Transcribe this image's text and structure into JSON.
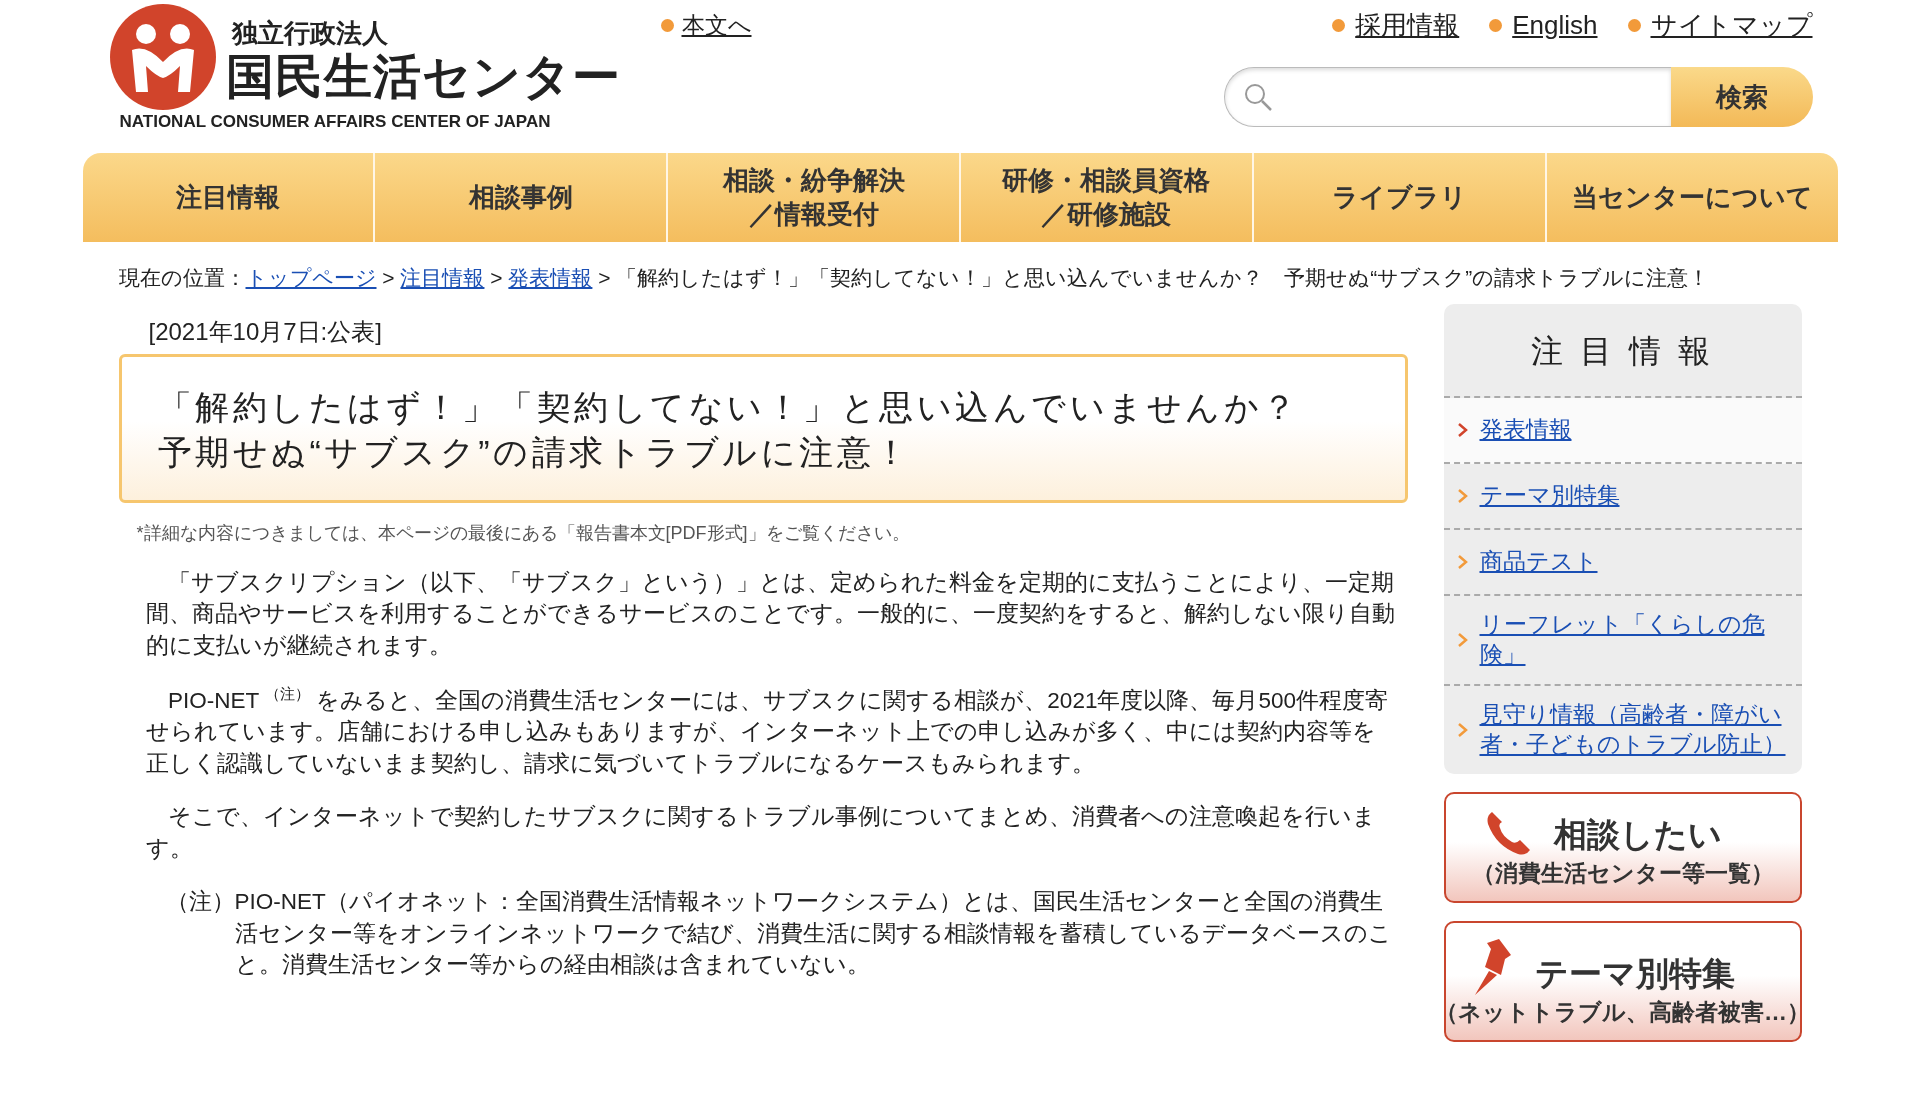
{
  "header": {
    "logo": {
      "org_type": "独立行政法人",
      "name": "国民生活センター",
      "english": "NATIONAL CONSUMER AFFAIRS CENTER OF JAPAN"
    },
    "skip_link": "本文へ",
    "top_links": [
      "採用情報",
      "English",
      "サイトマップ"
    ],
    "search": {
      "button": "検索"
    }
  },
  "nav": [
    {
      "lines": [
        "注目情報"
      ]
    },
    {
      "lines": [
        "相談事例"
      ]
    },
    {
      "lines": [
        "相談・紛争解決",
        "／情報受付"
      ]
    },
    {
      "lines": [
        "研修・相談員資格",
        "／研修施設"
      ]
    },
    {
      "lines": [
        "ライブラリ"
      ]
    },
    {
      "lines": [
        "当センターについて"
      ]
    }
  ],
  "breadcrumb": {
    "prefix": "現在の位置：",
    "links": [
      "トップページ",
      "注目情報",
      "発表情報"
    ],
    "separator": ">",
    "current": "「解約したはず！」「契約してない！」と思い込んでいませんか？　予期せぬ“サブスク”の請求トラブルに注意！"
  },
  "date": "[2021年10月7日:公表]",
  "title_lines": [
    "「解約したはず！」「契約してない！」と思い込んでいませんか？",
    "予期せぬ“サブスク”の請求トラブルに注意！"
  ],
  "note": "*詳細な内容につきましては、本ページの最後にある「報告書本文[PDF形式]」をご覧ください。",
  "paragraphs": [
    "「サブスクリプション（以下、「サブスク」という）」とは、定められた料金を定期的に支払うことにより、一定期間、商品やサービスを利用することができるサービスのことです。一般的に、一度契約をすると、解約しない限り自動的に支払いが継続されます。",
    "PIO-NET $^{（注）}$ をみると、全国の消費生活センターには、サブスクに関する相談が、2021年度以降、毎月500件程度寄せられています。店舗における申し込みもありますが、インターネット上での申し込みが多く、中には契約内容等を正しく認識していないまま契約し、請求に気づいてトラブルになるケースもみられます。",
    "そこで、インターネットで契約したサブスクに関するトラブル事例についてまとめ、消費者への注意喚起を行います。"
  ],
  "footnote": {
    "mark": "（注）",
    "text": "PIO-NET（パイオネット：全国消費生活情報ネットワークシステム）とは、国民生活センターと全国の消費生活センター等をオンラインネットワークで結び、消費生活に関する相談情報を蓄積しているデータベースのこと。消費生活センター等からの経由相談は含まれていない。"
  },
  "sidebar": {
    "heading": "注 目 情 報",
    "items": [
      {
        "label": "発表情報",
        "selected": true
      },
      {
        "label": "テーマ別特集",
        "selected": false
      },
      {
        "label": "商品テスト",
        "selected": false
      },
      {
        "label": "リーフレット「くらしの危険」",
        "selected": false
      },
      {
        "label": "見守り情報（高齢者・障がい者・子どものトラブル防止）",
        "selected": false
      }
    ]
  },
  "banners": [
    {
      "kind": "phone",
      "title": "相談したい",
      "subtitle": "（消費生活センター等一覧）"
    },
    {
      "kind": "pin",
      "title": "テーマ別特集",
      "subtitle": "（ネットトラブル、高齢者被害…）"
    }
  ]
}
